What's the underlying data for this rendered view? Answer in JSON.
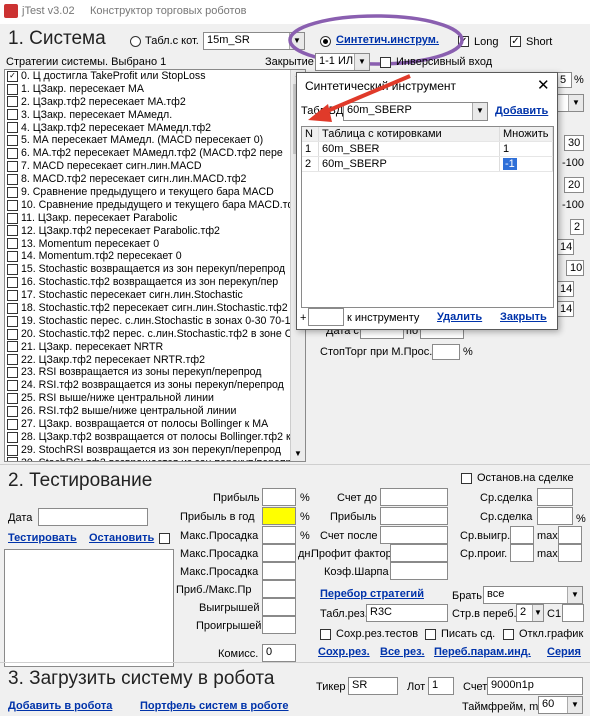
{
  "window": {
    "title_left": "jTest v3.02",
    "title_right": "Конструктор торговых роботов"
  },
  "system": {
    "heading": "1. Система",
    "radio_table_label": "Табл.с кот.",
    "table_value": "15m_SR",
    "radio_synth_label": "Синтетич.инструм.",
    "long_label": "Long",
    "short_label": "Short",
    "strategies_label": "Стратегии системы. Выбрано 1",
    "closing_label": "Закрытие",
    "closing_value": "1-1 ИЛИ та",
    "inverse_label": "Инверсивный вход",
    "strategies": [
      "0. Ц достигла TakeProfit или StopLoss",
      "1. ЦЗакр. пересекает МА",
      "2. ЦЗакр.тф2 пересекает МА.тф2",
      "3. ЦЗакр. пересекает МАмедл.",
      "4. ЦЗакр.тф2 пересекает МАмедл.тф2",
      "5. МА пересекает МАмедл. (MACD пересекает 0)",
      "6. МА.тф2 пересекает МАмедл.тф2 (MACD.тф2 пере",
      "7. MACD пересекает сигн.лин.MACD",
      "8. MACD.тф2 пересекает сигн.лин.MACD.тф2",
      "9. Сравнение предыдущего и текущего бара MACD",
      "10. Сравнение предыдущего и текущего бара MACD.тф",
      "11. ЦЗакр. пересекает Parabolic",
      "12. ЦЗакр.тф2 пересекает Parabolic.тф2",
      "13. Momentum пересекает 0",
      "14. Momentum.тф2 пересекает 0",
      "15. Stochastic возвращается из зон перекуп/перепрод",
      "16. Stochastic.тф2 возвращается из зон перекуп/пер",
      "17. Stochastic пересекает сигн.лин.Stochastic",
      "18. Stochastic.тф2 пересекает сигн.лин.Stochastic.тф2",
      "19. Stochastic перес. с.лин.Stochastic в зонах 0-30 70-1",
      "20. Stochastic.тф2 перес. с.лин.Stochastic.тф2 в зоне С",
      "21. ЦЗакр. пересекает NRTR",
      "22. ЦЗакр.тф2 пересекает NRTR.тф2",
      "23. RSI возвращается из зоны перекуп/перепрод",
      "24. RSI.тф2 возвращается из зоны перекуп/перепрод",
      "25. RSI выше/ниже центральной линии",
      "26. RSI.тф2 выше/ниже центральной линии",
      "27. ЦЗакр. возвращается от полосы Bollinger к МА",
      "28. ЦЗакр.тф2 возвращается от полосы Bollinger.тф2 к",
      "29. StochRSI возвращается из зон перекуп/перепрод",
      "30. StochRSI.тф2 возвращается из зон перекуп/перепр"
    ],
    "right_values": [
      "5",
      "30",
      "-100",
      "20",
      "-100",
      "2",
      "14",
      "10",
      "14",
      "14"
    ],
    "right_pct": "%",
    "date_label": "Дата с",
    "date_to_label": "по",
    "stop_label": "СтопТорг при М.Прос.",
    "stop_pct": "%"
  },
  "dialog": {
    "title": "Синтетический инструмент",
    "table_label": "Табл.БД",
    "table_value": "60m_SBERP",
    "add_label": "Добавить",
    "columns": [
      "N",
      "Таблица с котировками",
      "Множить"
    ],
    "rows": [
      {
        "n": "1",
        "table": "60m_SBER",
        "mult": "1"
      },
      {
        "n": "2",
        "table": "60m_SBERP",
        "mult": "-1"
      }
    ],
    "plus": "+",
    "to_instrument_label": "к инструменту",
    "delete_label": "Удалить",
    "close_label": "Закрыть"
  },
  "testing": {
    "heading": "2. Тестирование",
    "stop_on_deal": "Останов.на сделке",
    "date_label": "Дата",
    "test_link": "Тестировать",
    "stop_link": "Остановить",
    "profit": "Прибыль",
    "profit_year": "Прибыль в год",
    "max_dd": "Макс.Просадка",
    "max_dd2": "Макс.Просадка",
    "max_dd3": "Макс.Просадка",
    "profit_dd": "Приб./Макс.Пр",
    "wins": "Выигрышей",
    "losses": "Проигрышей",
    "commission": "Комисс.",
    "commission_value": "0",
    "pct": "%",
    "days": "дн.",
    "count_to": "Счет до",
    "profit2": "Прибыль",
    "count_after": "Счет после",
    "profit_factor": "Профит фактор",
    "sharpe": "Коэф.Шарпа",
    "avg_deal": "Ср.сделка",
    "avg_deal2": "Ср.сделка",
    "avg_win": "Ср.выигр.",
    "avg_loss": "Ср.проиг.",
    "max1": "max",
    "max2": "max",
    "enum_link": "Перебор стратегий",
    "take_label": "Брать",
    "take_value": "все",
    "results_label": "Табл.рез.",
    "results_value": "R3C",
    "page_label": "Стр.в переб.",
    "page_value": "2",
    "c1": "C1",
    "save_tests": "Сохр.рез.тестов",
    "write_deals": "Писать сд.",
    "disable_chart": "Откл.график",
    "save_res": "Сохр.рез.",
    "all_res": "Все рез.",
    "enum_params": "Переб.парам.инд.",
    "series": "Серия"
  },
  "robot": {
    "heading": "3. Загрузить систему в робота",
    "ticker_label": "Тикер",
    "ticker_value": "SR",
    "lot_label": "Лот",
    "lot_value": "1",
    "account_label": "Счет",
    "account_value": "9000n1p",
    "add_robot": "Добавить в робота",
    "portfolio": "Портфель систем в роботе",
    "timeframe_label": "Таймфрейм, m",
    "timeframe_value": "60"
  },
  "colors": {
    "highlight": "#ffff00",
    "oval": "#8a5fb0",
    "arrow": "#e03a2a",
    "link": "#0033aa",
    "selected": "#3070d8"
  }
}
